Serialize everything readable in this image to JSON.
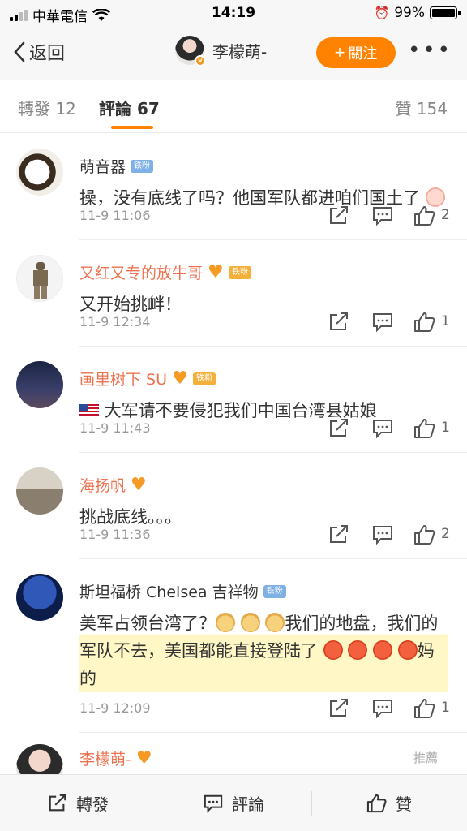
{
  "status": {
    "carrier": "中華電信",
    "time": "14:19",
    "battery": "99%"
  },
  "header": {
    "back_label": "返回",
    "username": "李檬萌-",
    "follow_label": "關注"
  },
  "tabs": {
    "repost_label": "轉發",
    "repost_count": "12",
    "comment_label": "評論",
    "comment_count": "67",
    "like_label": "贊",
    "like_count": "154"
  },
  "comments": [
    {
      "name": "萌音器",
      "badge": "铁粉",
      "text": "操，没有底线了吗？他国军队都进咱们国土了",
      "time": "11-9 11:06",
      "likes": "2"
    },
    {
      "name": "又红又专的放牛哥",
      "badge": "铁粉",
      "text": "又开始挑衅！",
      "time": "11-9 12:34",
      "likes": "1"
    },
    {
      "name": "画里树下 SU",
      "badge": "铁粉",
      "text": "大军请不要侵犯我们中国台湾县姑娘",
      "time": "11-9 11:43",
      "likes": "1"
    },
    {
      "name": "海扬帆",
      "badge": "",
      "text": "挑战底线。。。",
      "time": "11-9 11:36",
      "likes": "2"
    },
    {
      "name": "斯坦福桥 Chelsea 吉祥物",
      "badge": "铁粉",
      "text_a": "美军占领台湾了？",
      "text_b": "我们的地盘，我们的军队不去，美国都能直接登陆了",
      "text_c": "妈的",
      "time": "11-9 12:09",
      "likes": "1"
    }
  ],
  "partial_comment": {
    "name": "李檬萌-",
    "pinned": "推薦"
  },
  "bottom": {
    "repost_label": "轉發",
    "comment_label": "評論",
    "like_label": "贊"
  },
  "colors": {
    "accent": "#ff8200",
    "vip_name": "#eb7350",
    "fan_badge": "#7fb0e6"
  }
}
